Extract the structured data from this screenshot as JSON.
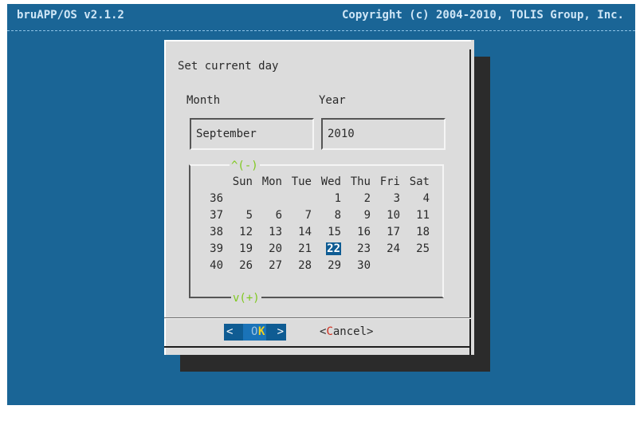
{
  "app": {
    "title": "bruAPP/OS v2.1.2",
    "copyright": "Copyright (c) 2004-2010, TOLIS Group, Inc."
  },
  "dialog": {
    "title": "Set current day",
    "month_label": "Month",
    "year_label": "Year",
    "month_value": "September",
    "year_value": "2010"
  },
  "calendar": {
    "scroll_up": "^(-)",
    "scroll_down": "v(+)",
    "weekdays": [
      "Sun",
      "Mon",
      "Tue",
      "Wed",
      "Thu",
      "Fri",
      "Sat"
    ],
    "weeks": [
      {
        "week": "36",
        "days": [
          "",
          "",
          "",
          "1",
          "2",
          "3",
          "4"
        ]
      },
      {
        "week": "37",
        "days": [
          "5",
          "6",
          "7",
          "8",
          "9",
          "10",
          "11"
        ]
      },
      {
        "week": "38",
        "days": [
          "12",
          "13",
          "14",
          "15",
          "16",
          "17",
          "18"
        ]
      },
      {
        "week": "39",
        "days": [
          "19",
          "20",
          "21",
          "22",
          "23",
          "24",
          "25"
        ]
      },
      {
        "week": "40",
        "days": [
          "26",
          "27",
          "28",
          "29",
          "30",
          "",
          ""
        ]
      }
    ],
    "selected_day": "22"
  },
  "buttons": {
    "ok": {
      "left": "<",
      "pre": " ",
      "hot": "O",
      "post": "K",
      "right": ">"
    },
    "cancel": {
      "open": "<",
      "hot": "C",
      "rest": "ancel",
      "close": ">"
    }
  },
  "colors": {
    "screen_bg": "#1a6596",
    "dialog_bg": "#dcdcdc",
    "selection": "#0f5c93",
    "arrow_green": "#7fc81f",
    "hotkey_red": "#d12c1c",
    "ok_hotkey_yellow": "#f0d020"
  }
}
